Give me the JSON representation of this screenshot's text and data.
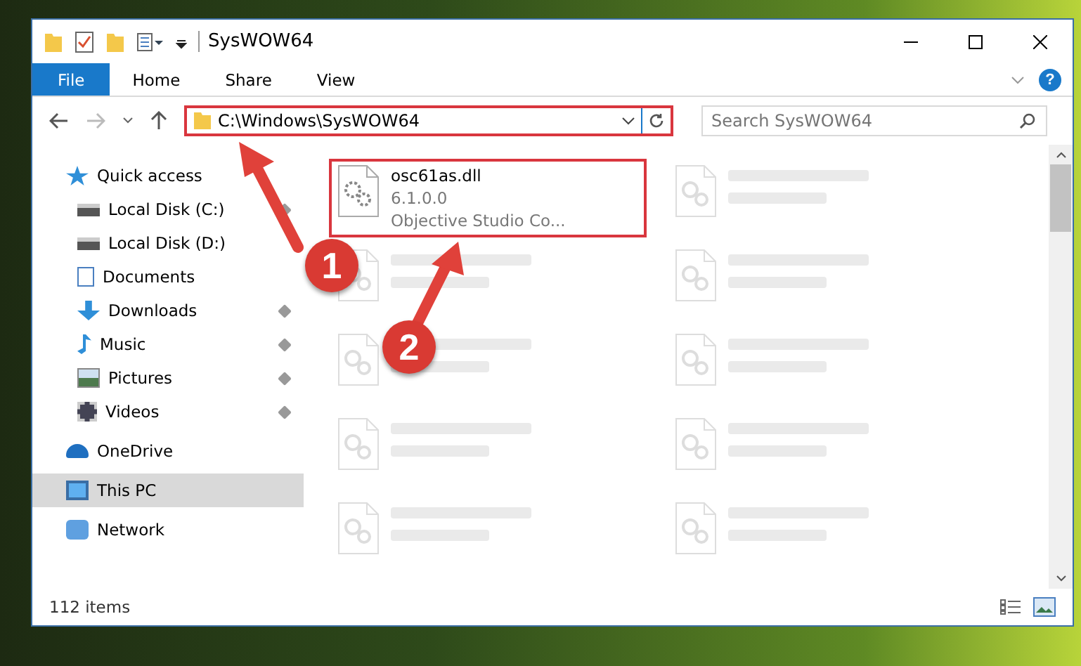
{
  "window": {
    "title": "SysWOW64"
  },
  "ribbon_tabs": [
    {
      "label": "File",
      "kind": "file"
    },
    {
      "label": "Home",
      "kind": "tab"
    },
    {
      "label": "Share",
      "kind": "tab"
    },
    {
      "label": "View",
      "kind": "tab"
    }
  ],
  "help_button": {
    "label": "?"
  },
  "address_bar": {
    "path": "C:\\Windows\\SysWOW64",
    "highlighted": true
  },
  "search": {
    "placeholder": "Search SysWOW64"
  },
  "sidebar": {
    "items": [
      {
        "label": "Quick access",
        "kind": "star",
        "selected": false,
        "children": [
          {
            "label": "Local Disk (C:)",
            "kind": "disk",
            "pinned": true,
            "selected": false
          },
          {
            "label": "Local Disk (D:)",
            "kind": "disk",
            "pinned": false,
            "selected": false
          },
          {
            "label": "Documents",
            "kind": "doc",
            "pinned": false,
            "selected": false
          },
          {
            "label": "Downloads",
            "kind": "download",
            "pinned": true,
            "selected": false
          },
          {
            "label": "Music",
            "kind": "music",
            "pinned": true,
            "selected": false
          },
          {
            "label": "Pictures",
            "kind": "picture",
            "pinned": true,
            "selected": false
          },
          {
            "label": "Videos",
            "kind": "video",
            "pinned": true,
            "selected": false
          }
        ]
      },
      {
        "label": "OneDrive",
        "kind": "cloud",
        "selected": false
      },
      {
        "label": "This PC",
        "kind": "pc",
        "selected": true
      },
      {
        "label": "Network",
        "kind": "network",
        "selected": false
      }
    ]
  },
  "files": [
    {
      "kind": "file",
      "name": "osc61as.dll",
      "lines": [
        "6.1.0.0",
        "Objective Studio Co..."
      ],
      "highlighted": true
    },
    {
      "kind": "blurred"
    },
    {
      "kind": "blurred"
    },
    {
      "kind": "blurred"
    },
    {
      "kind": "blurred"
    },
    {
      "kind": "blurred"
    },
    {
      "kind": "blurred"
    },
    {
      "kind": "blurred"
    },
    {
      "kind": "blurred"
    },
    {
      "kind": "blurred"
    }
  ],
  "status_bar": {
    "item_count": "112 items"
  },
  "annotations": [
    {
      "number": "1"
    },
    {
      "number": "2"
    }
  ]
}
